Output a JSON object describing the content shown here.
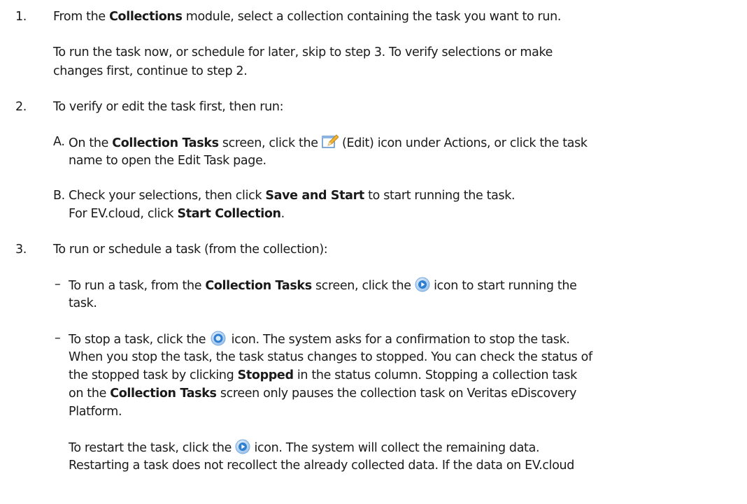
{
  "step1": {
    "number": "1.",
    "text_a": "From the ",
    "bold": "Collections",
    "text_b": " module, select a collection containing the task you want to run.",
    "note_line1": "To run the task now, or schedule for later, skip to step 3. To verify selections or make",
    "note_line2": "changes first, continue to step 2."
  },
  "step2": {
    "number": "2.",
    "intro": "To verify or edit the task first, then run:",
    "a": {
      "letter": "A.",
      "text_a": "On the ",
      "bold": "Collection Tasks",
      "text_b": " screen, click the ",
      "text_c": " (Edit) icon under Actions, or click the task",
      "line2": "name to open the Edit Task page."
    },
    "b": {
      "letter": "B.",
      "text_a": "Check your selections, then click ",
      "bold": "Save and Start",
      "text_b": " to start running the task.",
      "line2_a": "For EV.cloud, click ",
      "line2_bold": "Start Collection",
      "line2_b": "."
    }
  },
  "step3": {
    "number": "3.",
    "intro": "To run or schedule a task (from the collection):",
    "bullet_char": "–",
    "run": {
      "text_a": "To run a task, from the ",
      "bold": "Collection Tasks",
      "text_b": " screen, click the ",
      "text_c": " icon to start running the",
      "line2": "task."
    },
    "stop": {
      "line1_a": "To stop a task, click the ",
      "line1_b": " icon. The system asks for a confirmation to stop the task.",
      "line2": "When you stop the task, the task status changes to stopped. You can check the status of",
      "line3_a": "the stopped task by clicking ",
      "line3_bold": "Stopped",
      "line3_b": " in the status column. Stopping a collection task",
      "line4_a": "on the ",
      "line4_bold": "Collection Tasks",
      "line4_b": " screen only pauses the collection task on Veritas eDiscovery",
      "line5": "Platform."
    },
    "restart": {
      "line1_a": "To restart the task, click the ",
      "line1_b": " icon. The system will collect the remaining data.",
      "line2": "Restarting a task does not recollect the already collected data. If the data on EV.cloud"
    }
  },
  "icons": {
    "edit": "edit-pencil-icon",
    "run": "play-circle-icon",
    "stop": "stop-circle-icon",
    "accent": "#2f7fd0"
  }
}
